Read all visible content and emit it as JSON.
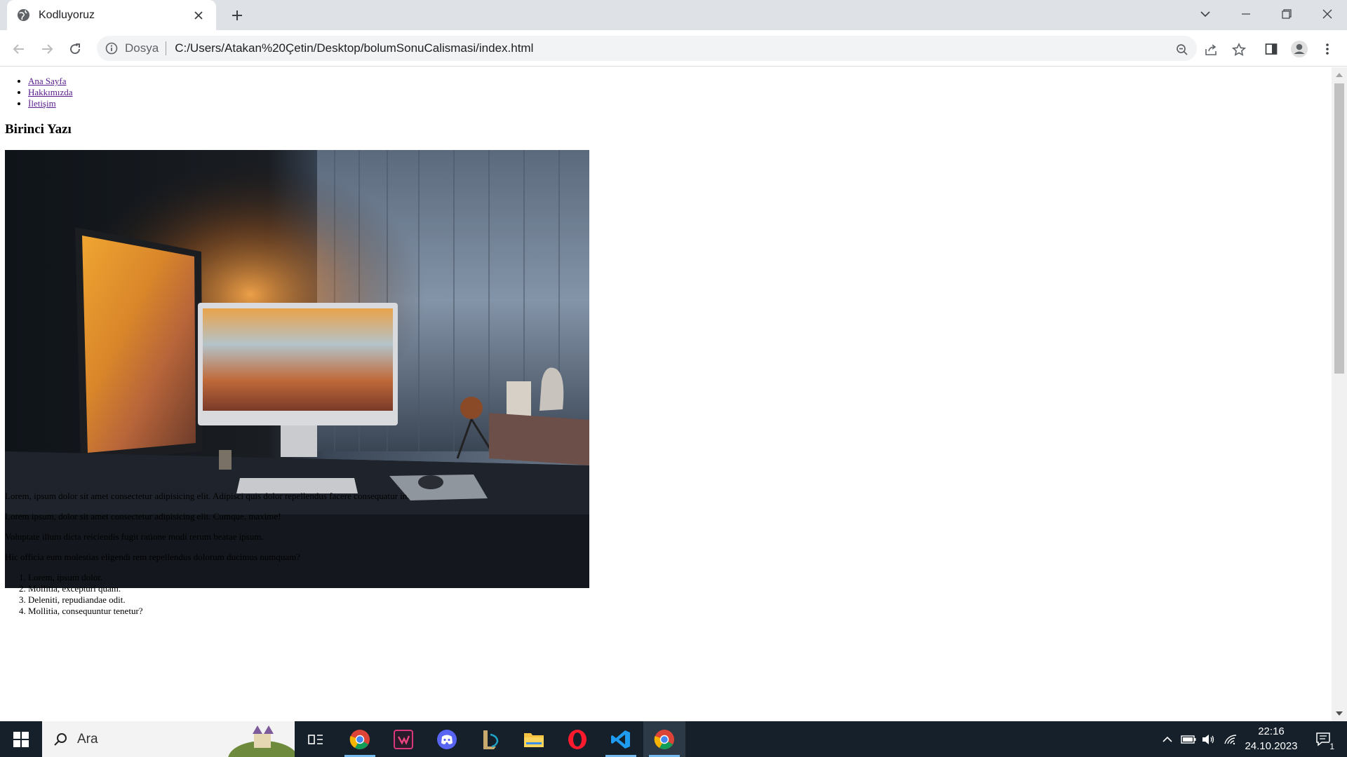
{
  "browser": {
    "tab_title": "Kodluyoruz",
    "omnibox": {
      "scheme_label": "Dosya",
      "url": "C:/Users/Atakan%20Çetin/Desktop/bolumSonuCalismasi/index.html"
    }
  },
  "page": {
    "nav": [
      "Ana Sayfa",
      "Hakkımızda",
      "İletişim"
    ],
    "heading": "Birinci Yazı",
    "paragraphs": [
      "Lorem, ipsum dolor sit amet consectetur adipisicing elit. Adipisci quis dolor repellendus facere consequatur in.",
      "Lorem ipsum, dolor sit amet consectetur adipisicing elit. Cumque, maxime!",
      "Voluptate illum dicta reiciendis fugit ratione modi rerum beatae ipsum.",
      "Hic officia eum molestias eligendi rem repellendus dolorum ducimus numquam?"
    ],
    "ordered_list": [
      "Lorem, ipsum dolor.",
      "Mollitia, excepturi quam.",
      "Deleniti, repudiandae odit.",
      "Mollitia, consequuntur tenetur?"
    ],
    "scroll_fraction": 0.0
  },
  "taskbar": {
    "search_label": "Ara",
    "time": "22:16",
    "date": "24.10.2023",
    "notification_count": "1",
    "apps": [
      "chrome",
      "xmind",
      "discord",
      "league-of-legends",
      "file-explorer",
      "opera",
      "vscode",
      "chrome"
    ]
  },
  "colors": {
    "tabstrip": "#dee1e6",
    "visited_link": "#551a8b",
    "taskbar": "#15202b"
  }
}
